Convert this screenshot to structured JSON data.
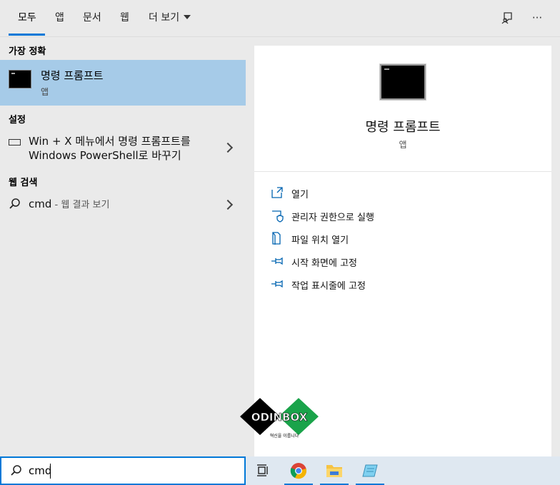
{
  "tabs": [
    {
      "label": "모두",
      "active": true
    },
    {
      "label": "앱"
    },
    {
      "label": "문서"
    },
    {
      "label": "웹"
    },
    {
      "label": "더 보기"
    }
  ],
  "top_icons": {
    "feedback": "feedback-icon",
    "more": "···"
  },
  "left": {
    "best_match_heading": "가장 정확",
    "best_match": {
      "title": "명령 프롬프트",
      "subtitle": "앱",
      "icon": "command-prompt-icon"
    },
    "settings_heading": "설정",
    "settings_item": {
      "line1": "Win + X 메뉴에서 명령 프롬프트를",
      "line2": "Windows PowerShell로 바꾸기",
      "icon": "keyboard-icon"
    },
    "web_heading": "웹 검색",
    "web_item": {
      "query": "cmd",
      "suffix": " - 웹 결과 보기",
      "icon": "search-icon"
    }
  },
  "right": {
    "title": "명령 프롬프트",
    "subtitle": "앱",
    "actions": [
      {
        "label": "열기",
        "icon": "open-icon"
      },
      {
        "label": "관리자 권한으로 실행",
        "icon": "admin-shield-icon"
      },
      {
        "label": "파일 위치 열기",
        "icon": "file-location-icon"
      },
      {
        "label": "시작 화면에 고정",
        "icon": "pin-icon"
      },
      {
        "label": "작업 표시줄에 고정",
        "icon": "pin-icon"
      }
    ]
  },
  "watermark": {
    "brand": "ODINBOX",
    "tagline": "혁신을 이룹니다"
  },
  "search": {
    "value": "cmd"
  },
  "taskbar": [
    "task-view-icon",
    "chrome-icon",
    "file-explorer-icon",
    "notepad-icon"
  ],
  "colors": {
    "accent": "#0078d7",
    "selected": "#a6cbe8",
    "panel": "#eaeaea"
  }
}
